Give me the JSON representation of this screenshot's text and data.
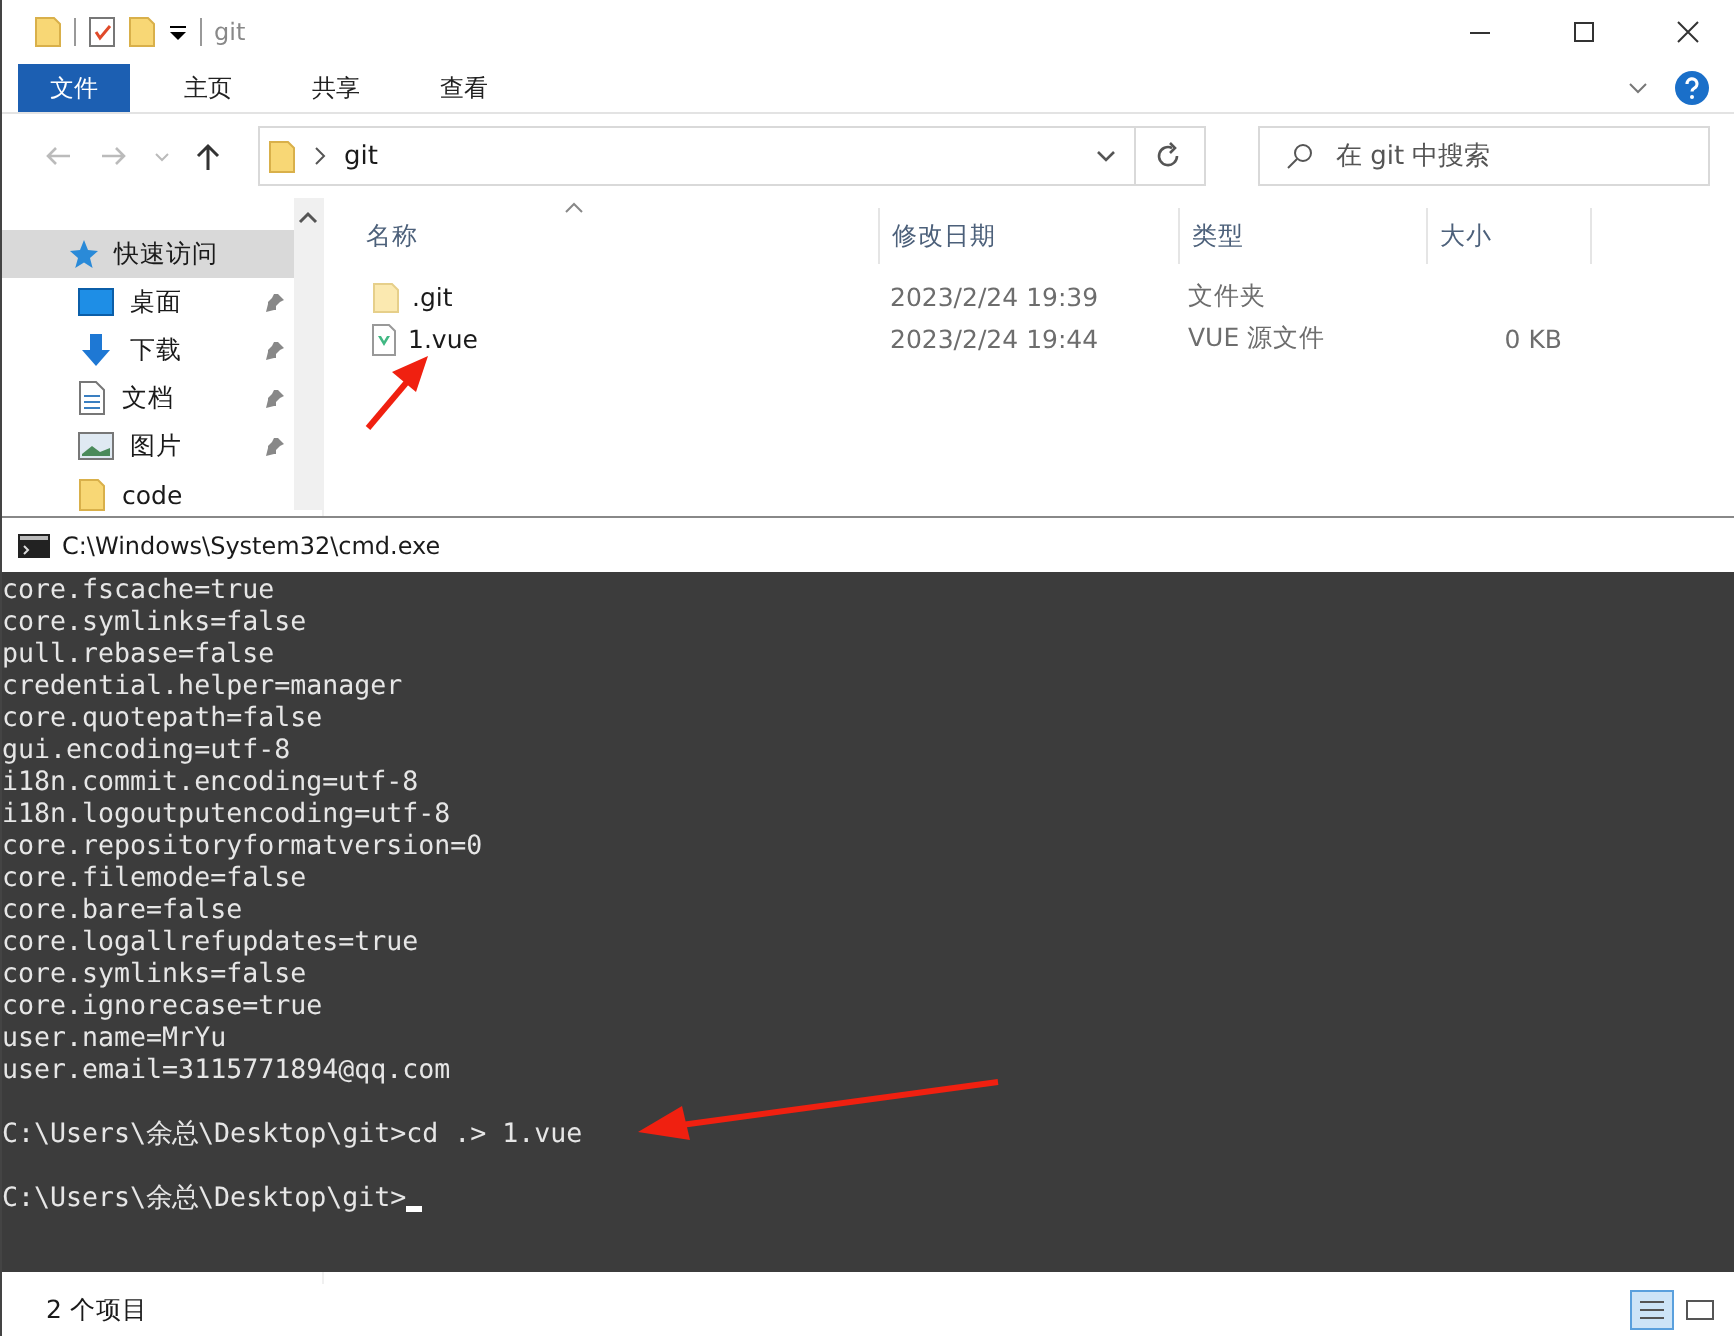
{
  "window": {
    "title": "git"
  },
  "ribbon_tabs": [
    {
      "label": "文件",
      "selected": true
    },
    {
      "label": "主页",
      "selected": false
    },
    {
      "label": "共享",
      "selected": false
    },
    {
      "label": "查看",
      "selected": false
    }
  ],
  "address": {
    "path": "git"
  },
  "search": {
    "placeholder": "在 git 中搜索"
  },
  "sidebar": {
    "items": [
      {
        "label": "快速访问",
        "kind": "star",
        "selected": true,
        "pinned": false
      },
      {
        "label": "桌面",
        "kind": "desktop",
        "selected": false,
        "pinned": true
      },
      {
        "label": "下载",
        "kind": "download",
        "selected": false,
        "pinned": true
      },
      {
        "label": "文档",
        "kind": "document",
        "selected": false,
        "pinned": true
      },
      {
        "label": "图片",
        "kind": "picture",
        "selected": false,
        "pinned": true
      },
      {
        "label": "code",
        "kind": "folder",
        "selected": false,
        "pinned": false
      }
    ]
  },
  "table": {
    "columns": [
      "名称",
      "修改日期",
      "类型",
      "大小"
    ],
    "rows": [
      {
        "kind": "folder",
        "cells": [
          ".git",
          "2023/2/24 19:39",
          "文件夹"
        ]
      },
      {
        "kind": "vue",
        "cells": [
          "1.vue",
          "2023/2/24 19:44",
          "VUE 源文件",
          "0 KB"
        ]
      }
    ]
  },
  "console": {
    "title": "C:\\Windows\\System32\\cmd.exe",
    "lines": [
      "core.fscache=true",
      "core.symlinks=false",
      "pull.rebase=false",
      "credential.helper=manager",
      "core.quotepath=false",
      "gui.encoding=utf-8",
      "i18n.commit.encoding=utf-8",
      "i18n.logoutputencoding=utf-8",
      "core.repositoryformatversion=0",
      "core.filemode=false",
      "core.bare=false",
      "core.logallrefupdates=true",
      "core.symlinks=false",
      "core.ignorecase=true",
      "user.name=MrYu",
      "user.email=3115771894@qq.com"
    ],
    "commands": [
      "C:\\Users\\余总\\Desktop\\git>cd .> 1.vue",
      "C:\\Users\\余总\\Desktop\\git>"
    ]
  },
  "status_bar": {
    "count": "2 个项目"
  }
}
